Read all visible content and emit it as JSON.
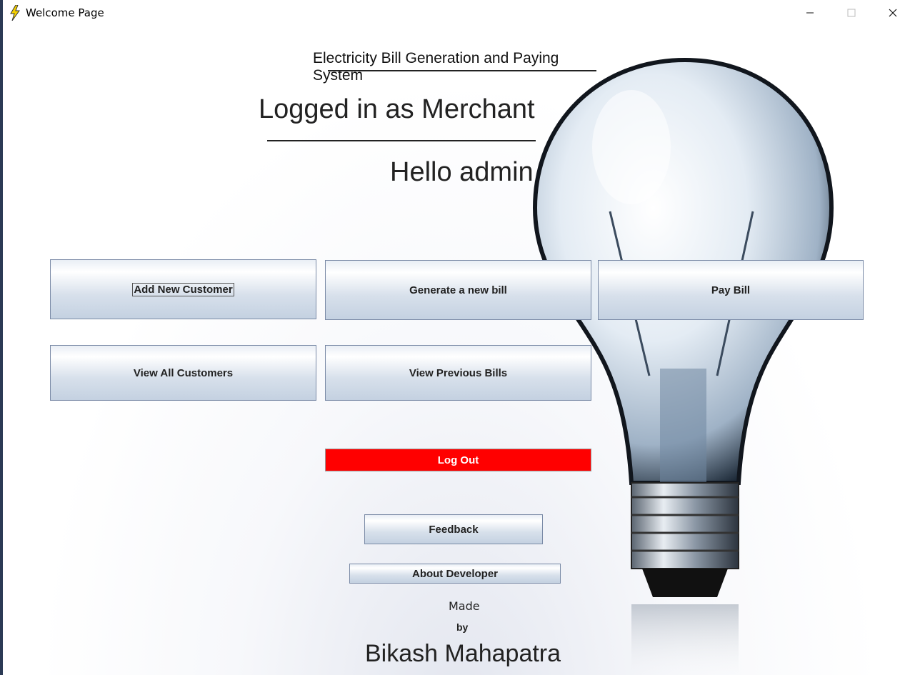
{
  "window": {
    "title": "Welcome Page",
    "icon": "lightning-icon",
    "controls": {
      "minimize": "—",
      "maximize": "☐",
      "close": "✕"
    }
  },
  "header": {
    "system_title": "Electricity Bill Generation and Paying System",
    "role_text": "Logged in as Merchant",
    "greeting": "Hello admin"
  },
  "buttons": {
    "add_customer": "Add New Customer",
    "generate_bill": "Generate a new bill",
    "pay_bill": "Pay Bill",
    "view_customers": "View All Customers",
    "view_bills": "View Previous Bills",
    "logout": "Log Out",
    "feedback": "Feedback",
    "about_developer": "About Developer"
  },
  "footer": {
    "made": "Made",
    "by": "by",
    "author": "Bikash Mahapatra"
  },
  "colors": {
    "logout_bg": "#ff0000",
    "accent": "#7a8aa6"
  }
}
